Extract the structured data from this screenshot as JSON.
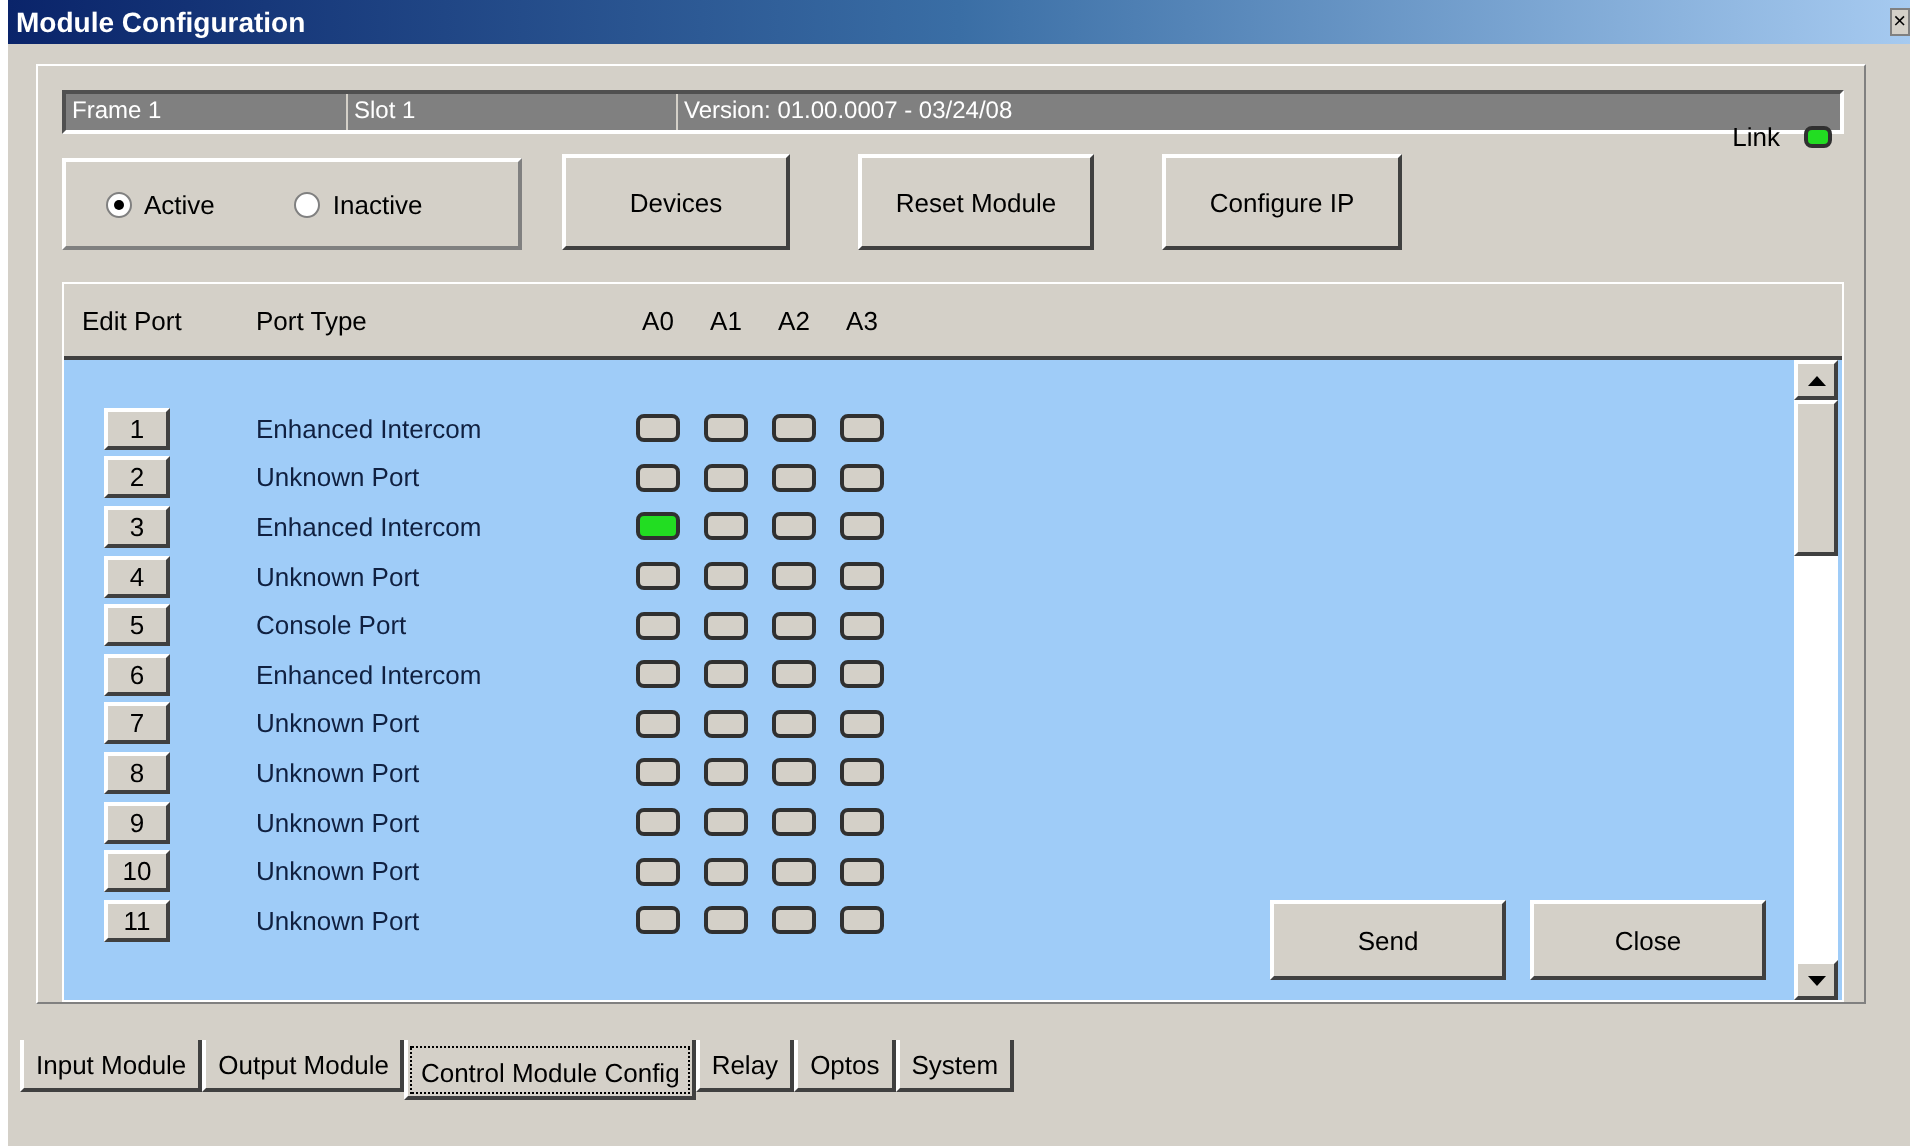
{
  "window": {
    "title": "Module Configuration",
    "close": "×"
  },
  "info_bar": [
    "Frame 1",
    "Slot 1",
    "Version: 01.00.0007 - 03/24/08"
  ],
  "link": {
    "label": "Link",
    "on": true
  },
  "mode": [
    {
      "label": "Active",
      "selected": true
    },
    {
      "label": "Inactive",
      "selected": false
    }
  ],
  "buttons": [
    "Devices",
    "Reset Module",
    "Configure IP"
  ],
  "table": {
    "columns": [
      "Edit Port",
      "Port Type",
      "A0",
      "A1",
      "A2",
      "A3"
    ],
    "rows": [
      {
        "port": "1",
        "type": "Enhanced Intercom",
        "lamps": [
          false,
          false,
          false,
          false
        ]
      },
      {
        "port": "2",
        "type": "Unknown Port",
        "lamps": [
          false,
          false,
          false,
          false
        ]
      },
      {
        "port": "3",
        "type": "Enhanced Intercom",
        "lamps": [
          true,
          false,
          false,
          false
        ]
      },
      {
        "port": "4",
        "type": "Unknown Port",
        "lamps": [
          false,
          false,
          false,
          false
        ]
      },
      {
        "port": "5",
        "type": "Console Port",
        "lamps": [
          false,
          false,
          false,
          false
        ]
      },
      {
        "port": "6",
        "type": "Enhanced Intercom",
        "lamps": [
          false,
          false,
          false,
          false
        ]
      },
      {
        "port": "7",
        "type": "Unknown Port",
        "lamps": [
          false,
          false,
          false,
          false
        ]
      },
      {
        "port": "8",
        "type": "Unknown Port",
        "lamps": [
          false,
          false,
          false,
          false
        ]
      },
      {
        "port": "9",
        "type": "Unknown Port",
        "lamps": [
          false,
          false,
          false,
          false
        ]
      },
      {
        "port": "10",
        "type": "Unknown Port",
        "lamps": [
          false,
          false,
          false,
          false
        ]
      },
      {
        "port": "11",
        "type": "Unknown Port",
        "lamps": [
          false,
          false,
          false,
          false
        ]
      }
    ]
  },
  "actions": [
    "Send",
    "Close"
  ],
  "tabs": [
    {
      "label": "Input Module",
      "selected": false
    },
    {
      "label": "Output Module",
      "selected": false
    },
    {
      "label": "Control Module Config",
      "selected": true
    },
    {
      "label": "Relay",
      "selected": false
    },
    {
      "label": "Optos",
      "selected": false
    },
    {
      "label": "System",
      "selected": false
    }
  ]
}
